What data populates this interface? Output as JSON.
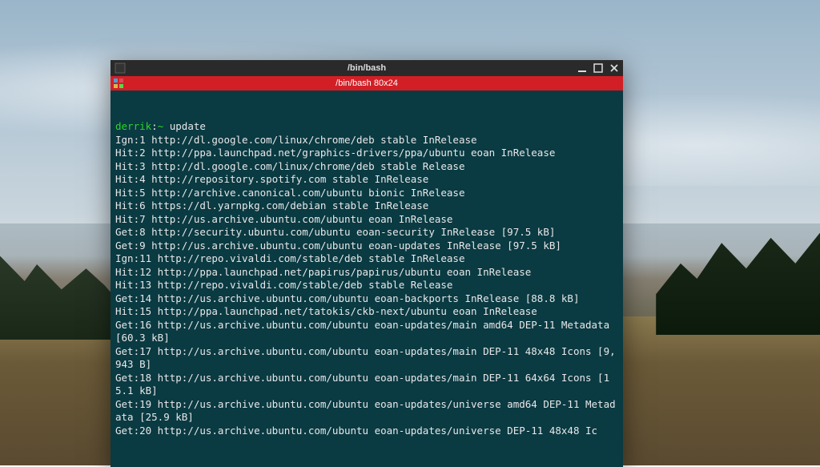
{
  "window": {
    "title": "/bin/bash",
    "tab_title": "/bin/bash 80x24"
  },
  "terminal": {
    "prompt": {
      "user": "derrik",
      "separator": ":",
      "path": "~",
      "command": "update"
    },
    "lines": [
      "Ign:1 http://dl.google.com/linux/chrome/deb stable InRelease",
      "Hit:2 http://ppa.launchpad.net/graphics-drivers/ppa/ubuntu eoan InRelease",
      "Hit:3 http://dl.google.com/linux/chrome/deb stable Release",
      "Hit:4 http://repository.spotify.com stable InRelease",
      "Hit:5 http://archive.canonical.com/ubuntu bionic InRelease",
      "Hit:6 https://dl.yarnpkg.com/debian stable InRelease",
      "Hit:7 http://us.archive.ubuntu.com/ubuntu eoan InRelease",
      "Get:8 http://security.ubuntu.com/ubuntu eoan-security InRelease [97.5 kB]",
      "Get:9 http://us.archive.ubuntu.com/ubuntu eoan-updates InRelease [97.5 kB]",
      "Ign:11 http://repo.vivaldi.com/stable/deb stable InRelease",
      "Hit:12 http://ppa.launchpad.net/papirus/papirus/ubuntu eoan InRelease",
      "Hit:13 http://repo.vivaldi.com/stable/deb stable Release",
      "Get:14 http://us.archive.ubuntu.com/ubuntu eoan-backports InRelease [88.8 kB]",
      "Hit:15 http://ppa.launchpad.net/tatokis/ckb-next/ubuntu eoan InRelease",
      "Get:16 http://us.archive.ubuntu.com/ubuntu eoan-updates/main amd64 DEP-11 Metadata [60.3 kB]",
      "Get:17 http://us.archive.ubuntu.com/ubuntu eoan-updates/main DEP-11 48x48 Icons [9,943 B]",
      "Get:18 http://us.archive.ubuntu.com/ubuntu eoan-updates/main DEP-11 64x64 Icons [15.1 kB]",
      "Get:19 http://us.archive.ubuntu.com/ubuntu eoan-updates/universe amd64 DEP-11 Metadata [25.9 kB]",
      "Get:20 http://us.archive.ubuntu.com/ubuntu eoan-updates/universe DEP-11 48x48 Ic"
    ]
  }
}
